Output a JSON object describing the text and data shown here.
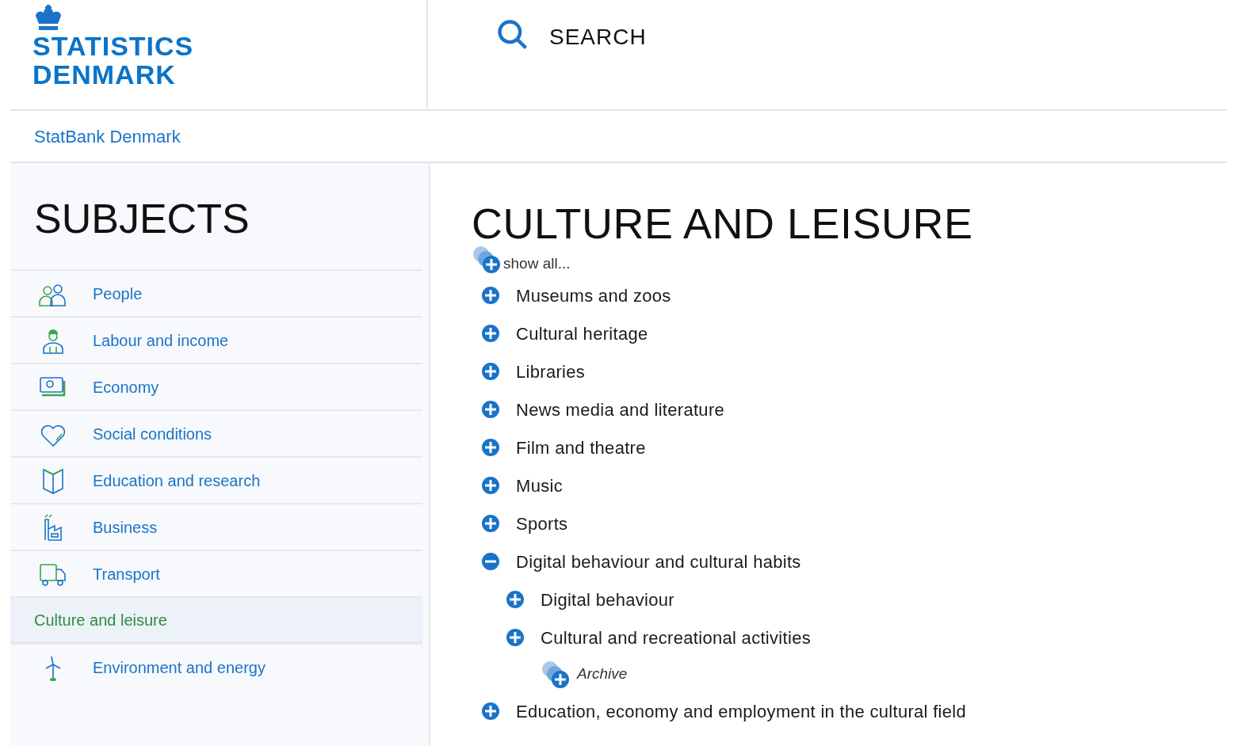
{
  "logo": {
    "line1": "STATISTICS",
    "line2": "DENMARK"
  },
  "search": {
    "label": "SEARCH"
  },
  "breadcrumb": "StatBank Denmark",
  "sidebar": {
    "title": "SUBJECTS",
    "items": [
      {
        "label": "People",
        "selected": false
      },
      {
        "label": "Labour and income",
        "selected": false
      },
      {
        "label": "Economy",
        "selected": false
      },
      {
        "label": "Social conditions",
        "selected": false
      },
      {
        "label": "Education and research",
        "selected": false
      },
      {
        "label": "Business",
        "selected": false
      },
      {
        "label": "Transport",
        "selected": false
      },
      {
        "label": "Culture and leisure",
        "selected": true
      },
      {
        "label": "Environment and energy",
        "selected": false
      }
    ]
  },
  "main": {
    "title": "CULTURE AND LEISURE",
    "show_all": "show all...",
    "tree": [
      {
        "kind": "topic",
        "label": "Museums and zoos",
        "expanded": false
      },
      {
        "kind": "topic",
        "label": "Cultural heritage",
        "expanded": false
      },
      {
        "kind": "topic",
        "label": "Libraries",
        "expanded": false
      },
      {
        "kind": "topic",
        "label": "News media and literature",
        "expanded": false
      },
      {
        "kind": "topic",
        "label": "Film and theatre",
        "expanded": false
      },
      {
        "kind": "topic",
        "label": "Music",
        "expanded": false
      },
      {
        "kind": "topic",
        "label": "Sports",
        "expanded": false
      },
      {
        "kind": "topic",
        "label": "Digital behaviour and cultural habits",
        "expanded": true,
        "children": [
          {
            "kind": "topic",
            "label": "Digital behaviour",
            "expanded": false
          },
          {
            "kind": "topic",
            "label": "Cultural and recreational activities",
            "expanded": false
          },
          {
            "kind": "archive",
            "label": "Archive"
          }
        ]
      },
      {
        "kind": "topic",
        "label": "Education, economy and employment in the cultural field",
        "expanded": false
      }
    ]
  }
}
